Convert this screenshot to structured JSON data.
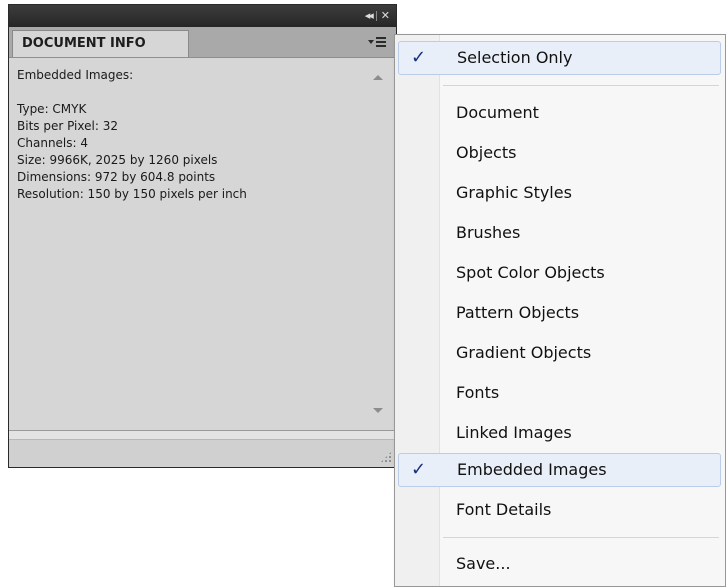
{
  "panel": {
    "title_tab": "DOCUMENT INFO",
    "controls": {
      "collapse": "◂◂",
      "close": "✕"
    },
    "content_lines": [
      "Embedded Images:",
      "",
      "Type: CMYK",
      "Bits per Pixel: 32",
      "Channels: 4",
      "Size: 9966K, 2025 by 1260 pixels",
      "Dimensions: 972 by 604.8 points",
      "Resolution: 150 by 150 pixels per inch"
    ]
  },
  "menu": {
    "check_glyph": "✓",
    "items": [
      {
        "label": "Selection Only",
        "checked": true
      },
      {
        "label": "Document",
        "checked": false
      },
      {
        "label": "Objects",
        "checked": false
      },
      {
        "label": "Graphic Styles",
        "checked": false
      },
      {
        "label": "Brushes",
        "checked": false
      },
      {
        "label": "Spot Color Objects",
        "checked": false
      },
      {
        "label": "Pattern Objects",
        "checked": false
      },
      {
        "label": "Gradient Objects",
        "checked": false
      },
      {
        "label": "Fonts",
        "checked": false
      },
      {
        "label": "Linked Images",
        "checked": false
      },
      {
        "label": "Embedded Images",
        "checked": true
      },
      {
        "label": "Font Details",
        "checked": false
      },
      {
        "label": "Save...",
        "checked": false
      }
    ]
  },
  "colors": {
    "panel_bg": "#d6d6d6",
    "titlebar": "#2f2f2f",
    "menu_bg": "#f7f7f7",
    "checked_bg": "#e8eff9",
    "check_color": "#1a2f7a"
  }
}
